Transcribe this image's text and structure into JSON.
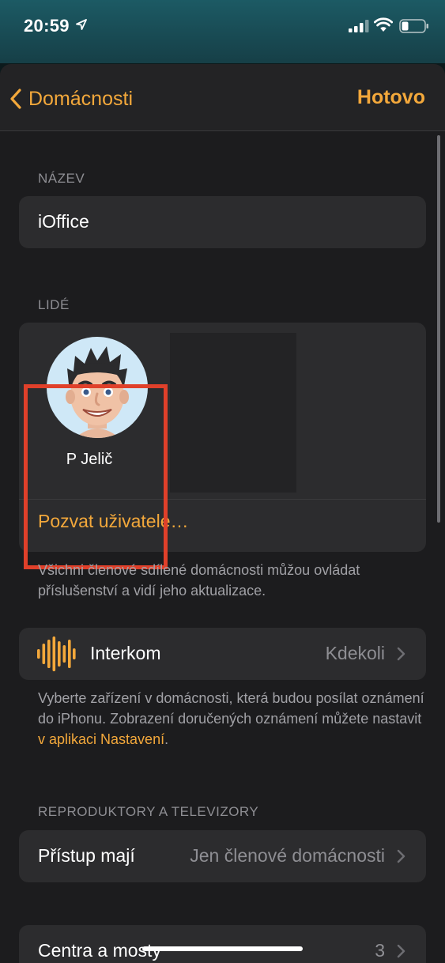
{
  "status_bar": {
    "time": "20:59"
  },
  "nav": {
    "back_label": "Domácnosti",
    "done_label": "Hotovo"
  },
  "name_section": {
    "header": "NÁZEV",
    "value": "iOffice"
  },
  "people_section": {
    "header": "LIDÉ",
    "members": [
      {
        "name": "P Jelič"
      }
    ],
    "invite_label": "Pozvat uživatele…",
    "footer": "Všichni členové sdílené domácnosti můžou ovládat příslušenství a vidí jeho aktualizace."
  },
  "intercom": {
    "label": "Interkom",
    "value": "Kdekoli",
    "footer_prefix": "Vyberte zařízení v domácnosti, která budou posílat oznámení do iPhonu. Zobrazení doručených oznámení můžete nastavit ",
    "footer_link": "v aplikaci Nastavení",
    "footer_suffix": "."
  },
  "speakers_section": {
    "header": "REPRODUKTORY A TELEVIZORY",
    "access_label": "Přístup mají",
    "access_value": "Jen členové domácnosti"
  },
  "hubs": {
    "label": "Centra a mosty",
    "value": "3"
  },
  "colors": {
    "accent": "#f3a83b",
    "highlight": "#e0402a",
    "background": "#1c1c1e",
    "card": "#2c2c2e"
  }
}
